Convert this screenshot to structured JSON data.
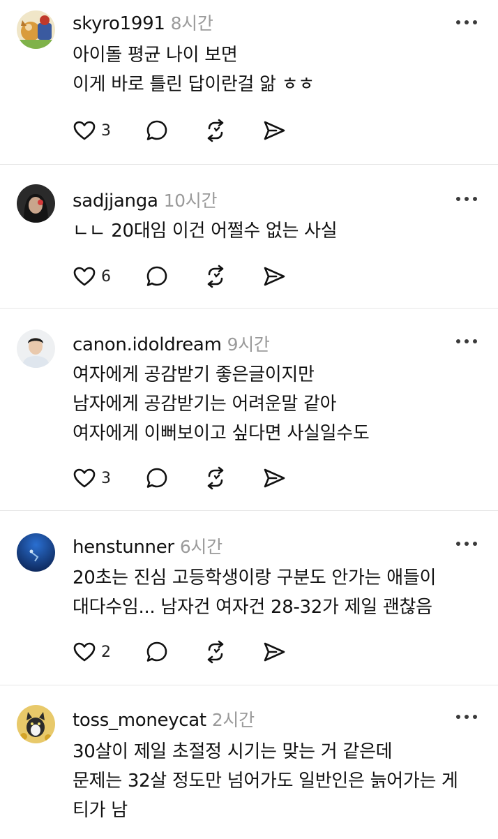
{
  "comments": [
    {
      "username": "skyro1991",
      "time": "8시간",
      "lines": [
        "아이돌 평균 나이 보면",
        "이게 바로 틀린 답이란걸 앎 ㅎㅎ"
      ],
      "likes": "3",
      "avatar": "avatar-dog"
    },
    {
      "username": "sadjjanga",
      "time": "10시간",
      "lines": [
        "ㄴㄴ 20대임 이건 어쩔수 없는 사실"
      ],
      "likes": "6",
      "avatar": "avatar-person-dark"
    },
    {
      "username": "canon.idoldream",
      "time": "9시간",
      "lines": [
        "여자에게 공감받기 좋은글이지만",
        "남자에게 공감받기는 어려운말 같아",
        "여자에게 이뻐보이고 싶다면 사실일수도"
      ],
      "likes": "3",
      "avatar": "avatar-person-light"
    },
    {
      "username": "henstunner",
      "time": "6시간",
      "lines": [
        "20초는 진심 고등학생이랑 구분도 안가는 애들이",
        "대다수임... 남자건 여자건 28-32가 제일 괜찮음"
      ],
      "likes": "2",
      "avatar": "avatar-ocean"
    },
    {
      "username": "toss_moneycat",
      "time": "2시간",
      "lines": [
        "30살이 제일 초절정 시기는 맞는 거 같은데",
        "문제는 32살 정도만 넘어가도 일반인은 늙어가는 게",
        "티가 남"
      ],
      "likes": "",
      "avatar": "avatar-cat"
    }
  ]
}
